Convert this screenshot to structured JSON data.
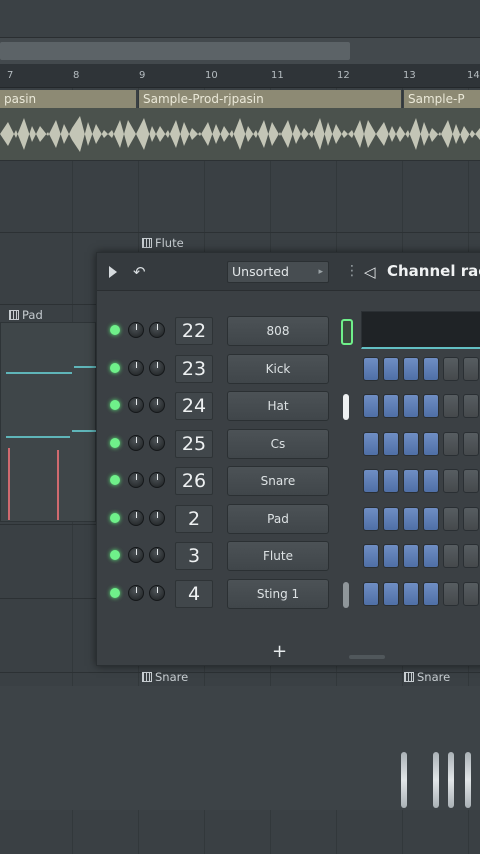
{
  "ruler": {
    "ticks": [
      "7",
      "8",
      "9",
      "10",
      "11",
      "12",
      "13",
      "14"
    ]
  },
  "clips": {
    "audio_left_label": "pasin",
    "audio_right_label": "Sample-Prod-rjpasin",
    "audio_far_right_label": "Sample-P",
    "pad_label": "Pad",
    "flute_label": "Flute",
    "snare_label_left": "Snare",
    "snare_label_right": "Snare"
  },
  "channel_rack": {
    "sort_label": "Unsorted",
    "title": "Channel rack",
    "add_label": "+",
    "channels": [
      {
        "number": "22",
        "name": "808",
        "steps": [
          0,
          0,
          0,
          0,
          0,
          0,
          0
        ]
      },
      {
        "number": "23",
        "name": "Kick",
        "steps": [
          1,
          1,
          1,
          1,
          0,
          0,
          0
        ]
      },
      {
        "number": "24",
        "name": "Hat",
        "steps": [
          1,
          1,
          1,
          1,
          0,
          0,
          0
        ]
      },
      {
        "number": "25",
        "name": "Cs",
        "steps": [
          1,
          1,
          1,
          1,
          0,
          0,
          0
        ]
      },
      {
        "number": "26",
        "name": "Snare",
        "steps": [
          1,
          1,
          1,
          1,
          0,
          0,
          0
        ]
      },
      {
        "number": "2",
        "name": "Pad",
        "steps": [
          1,
          1,
          1,
          1,
          0,
          0,
          0
        ]
      },
      {
        "number": "3",
        "name": "Flute",
        "steps": [
          1,
          1,
          1,
          1,
          0,
          0,
          0
        ]
      },
      {
        "number": "4",
        "name": "Sting 1",
        "steps": [
          1,
          1,
          1,
          1,
          0,
          0,
          0
        ]
      }
    ]
  },
  "colors": {
    "accent_teal": "#5fb5b9",
    "led_green": "#6ff08a",
    "step_on": "#5f7eb5",
    "clip_header": "#8d8a74"
  }
}
